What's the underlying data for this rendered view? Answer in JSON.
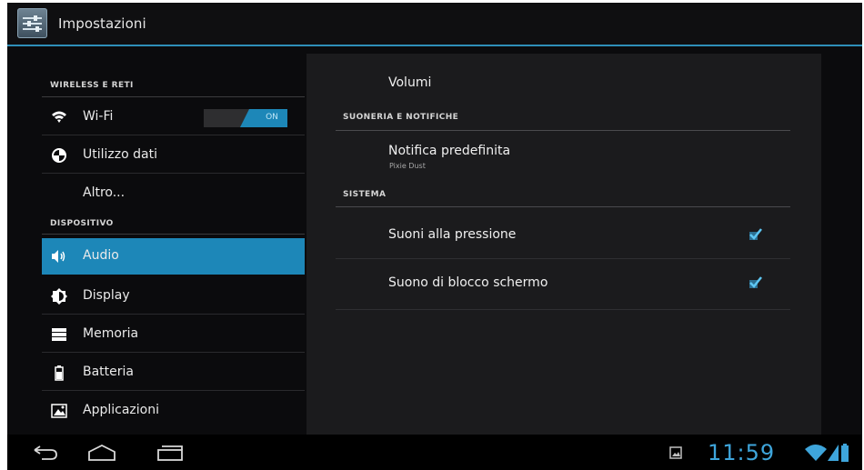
{
  "app_bar": {
    "title": "Impostazioni",
    "icon": "settings-app-icon"
  },
  "sidebar": {
    "section_wireless": "WIRELESS E RETI",
    "section_device": "DISPOSITIVO",
    "items": [
      {
        "label": "Wi-Fi",
        "icon": "wifi-icon"
      },
      {
        "label": "Utilizzo dati",
        "icon": "data-usage-icon"
      },
      {
        "label": "Altro...",
        "icon": ""
      },
      {
        "label": "Audio",
        "icon": "speaker-icon",
        "selected": true
      },
      {
        "label": "Display",
        "icon": "brightness-icon"
      },
      {
        "label": "Memoria",
        "icon": "storage-icon"
      },
      {
        "label": "Batteria",
        "icon": "battery-icon"
      },
      {
        "label": "Applicazioni",
        "icon": "apps-icon"
      }
    ],
    "wifi_toggle": {
      "label": "ON",
      "state": true
    }
  },
  "audio_settings": {
    "volumes_label": "Volumi",
    "section_ringtone": "SUONERIA E NOTIFICHE",
    "default_notification": {
      "title": "Notifica predefinita",
      "value": "Pixie Dust"
    },
    "section_system": "SISTEMA",
    "touch_sounds": {
      "label": "Suoni alla pressione",
      "checked": true
    },
    "lock_screen_sound": {
      "label": "Suono di blocco schermo",
      "checked": true
    }
  },
  "system_bar": {
    "time": "11:59",
    "icons": [
      "back-icon",
      "home-icon",
      "recent-apps-icon",
      "gallery-notification-icon",
      "wifi-signal-icon",
      "cell-signal-icon",
      "battery-status-icon"
    ]
  },
  "colors": {
    "accent": "#1d87b8",
    "clock": "#3ea5db",
    "background": "#0b0b0d",
    "panel": "#1b1b1d"
  }
}
